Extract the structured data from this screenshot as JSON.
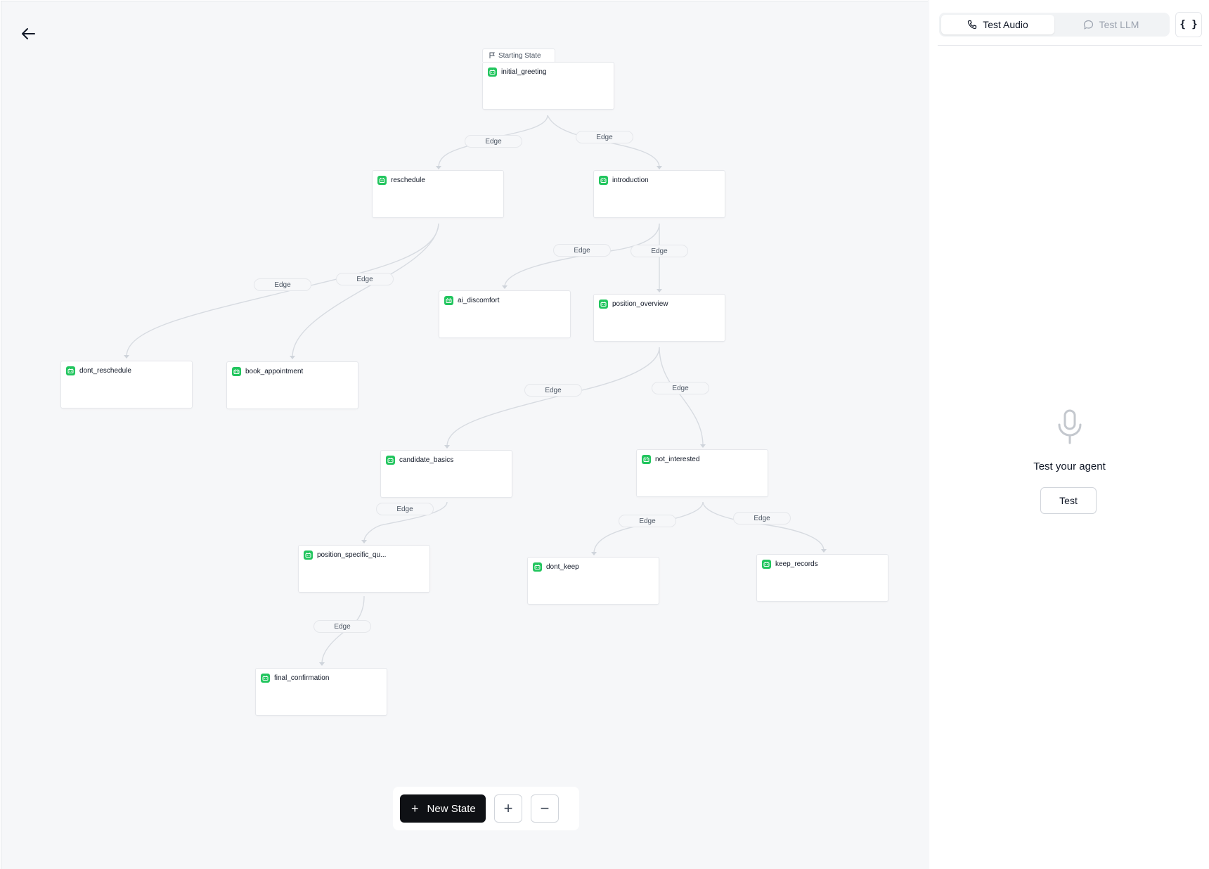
{
  "canvas": {
    "start_tag_label": "Starting State",
    "edge_label": "Edge",
    "states": [
      {
        "name": "initial_greeting"
      },
      {
        "name": "reschedule"
      },
      {
        "name": "introduction"
      },
      {
        "name": "ai_discomfort"
      },
      {
        "name": "position_overview"
      },
      {
        "name": "dont_reschedule"
      },
      {
        "name": "book_appointment"
      },
      {
        "name": "candidate_basics"
      },
      {
        "name": "not_interested"
      },
      {
        "name": "position_specific_qu..."
      },
      {
        "name": "dont_keep"
      },
      {
        "name": "keep_records"
      },
      {
        "name": "final_confirmation"
      }
    ]
  },
  "toolbar": {
    "new_state_label": "New State",
    "zoom_in_label": "+",
    "zoom_out_label": "−"
  },
  "panel": {
    "tabs": [
      {
        "label": "Test Audio",
        "icon": "phone-icon",
        "active": true
      },
      {
        "label": "Test LLM",
        "icon": "chat-bubble-icon",
        "active": false
      }
    ],
    "json_button_label": "{ }",
    "empty_state_title": "Test your agent",
    "test_button_label": "Test"
  },
  "colors": {
    "accent_green": "#22c55e",
    "primary_button": "#0f1115",
    "canvas_bg": "#f6f7f9"
  }
}
